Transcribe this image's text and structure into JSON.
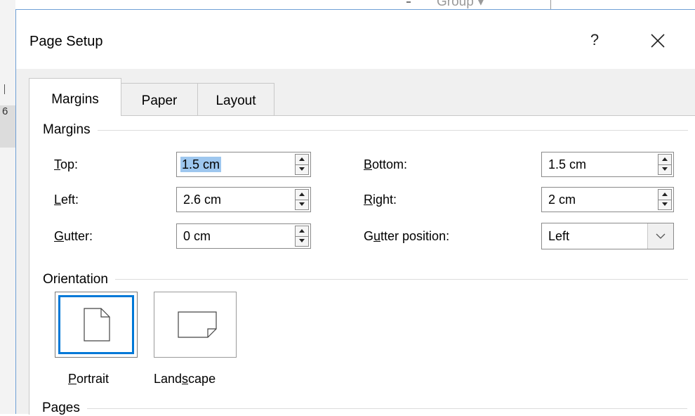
{
  "background": {
    "ribbon_text": "Group",
    "ruler_number": "6"
  },
  "dialog": {
    "title": "Page Setup",
    "help_label": "?",
    "close_icon": "close-icon"
  },
  "tabs": [
    {
      "label": "Margins",
      "active": true
    },
    {
      "label": "Paper",
      "active": false
    },
    {
      "label": "Layout",
      "active": false
    }
  ],
  "margins": {
    "group_label": "Margins",
    "top": {
      "accel": "T",
      "rest": "op:",
      "value": "1.5 cm"
    },
    "bottom": {
      "accel": "B",
      "rest": "ottom:",
      "value": "1.5 cm"
    },
    "left": {
      "accel": "L",
      "rest": "eft:",
      "value": "2.6 cm"
    },
    "right": {
      "accel": "R",
      "rest": "ight:",
      "value": "2 cm"
    },
    "gutter": {
      "accel": "G",
      "rest": "utter:",
      "value": "0 cm"
    },
    "gutter_position": {
      "pre": "G",
      "accel": "u",
      "rest": "tter position:",
      "value": "Left"
    }
  },
  "orientation": {
    "group_label": "Orientation",
    "portrait": {
      "accel": "P",
      "rest": "ortrait",
      "selected": true
    },
    "landscape": {
      "pre": "Land",
      "accel": "s",
      "rest": "cape",
      "selected": false
    }
  },
  "pages": {
    "group_label": "Pages"
  },
  "colors": {
    "accent": "#0078d7",
    "selection": "#9ec7ef",
    "dialog_border": "#6e9fd5"
  }
}
